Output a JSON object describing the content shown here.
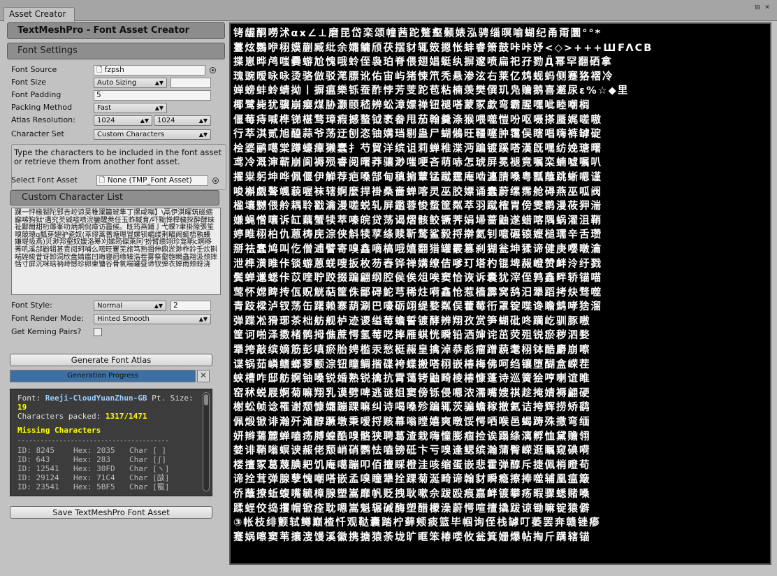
{
  "window": {
    "tab_title": "Asset Creator"
  },
  "header": {
    "title": "TextMeshPro - Font Asset Creator"
  },
  "settings": {
    "section_title": "Font Settings",
    "font_source": {
      "label": "Font Source",
      "value": "fzpsh"
    },
    "font_size": {
      "label": "Font Size",
      "value": "Auto Sizing"
    },
    "font_padding": {
      "label": "Font Padding",
      "value": "5"
    },
    "packing_method": {
      "label": "Packing Method",
      "value": "Fast"
    },
    "atlas_resolution": {
      "label": "Atlas Resolution:",
      "width": "1024",
      "height": "1024"
    },
    "character_set": {
      "label": "Character Set",
      "value": "Custom Characters"
    },
    "description": "Type the characters to be included in the font asset or retrieve them from another font asset.",
    "select_font_asset": {
      "label": "Select Font Asset",
      "value": "None (TMP_Font Asset)"
    },
    "custom_list_title": "Custom Character List",
    "custom_characters": "踝一怦椽猢陀郢吉崆谅昊稚瀾籭琥隼丁摞咸嘣】\\鬲伊淇曜筑磁缩廨嗦狗狱'遇究芡碱喧啧浣鑾醒莢任玉蚱馘育/吓黜惮桿穢探酔酵昧祉鄙爾甜桁蓐峯叻炳炯侃瘴访霾候。既筠燕鋪亅弋蜾?聿褂隙張笙嗅競璁q瓢芽翅驴瓷奴(萃缪蒿蔷塘嗯冒嫘钡嵋缕荆瞄阙蜓梧孰螓嫌堤圾燕)贝渺邦壑奴嫒洛筹刈娣筠磔萊阿'扮臂缋翊珍龛聃c婀眵莠叽溪郃鼢辑甚责阅珂哺么嘧旺矍芜旅笃熟揖伸鼎淤渺柞鈴壬炊斟喘姪睃昔讶卸洞欣盘婧扈凹晦寝阏缘臻浩茬雾祭壑匏瞬蟲翔汲颈摔恬寸屏沉咪晗衲峙憾珍卵柬镛谷骨氧喘罐昼谛钗弹衣婵雨颊蚜浇",
    "font_style": {
      "label": "Font Style:",
      "value": "Normal",
      "extra": "2"
    },
    "render_mode": {
      "label": "Font Render Mode:",
      "value": "Hinted Smooth"
    },
    "kerning": {
      "label": "Get Kerning Pairs?"
    }
  },
  "actions": {
    "generate": "Generate Font Atlas",
    "progress_label": "Generation Progress",
    "progress_value": 1.0,
    "save": "Save TextMeshPro Font Asset"
  },
  "console": {
    "font_label": "Font:",
    "font_name": "Reeji-CloudYuanZhun-GB",
    "pt_label": "Pt. Size:",
    "pt_size": "19",
    "packed_label": "Characters packed:",
    "packed": "1317/1471",
    "missing_title": "Missing Characters",
    "rule": "----------------------------------------",
    "missing": [
      {
        "id": "ID: 8245",
        "hex": "Hex: 2035",
        "char": "Char [ ]"
      },
      {
        "id": "ID: 643",
        "hex": "Hex: 283",
        "char": "Char [ʃ]"
      },
      {
        "id": "ID: 12541",
        "hex": "Hex: 30FD",
        "char": "Char [ヽ]"
      },
      {
        "id": "ID: 29124",
        "hex": "Hex: 71C4",
        "char": "Char [燄]"
      },
      {
        "id": "ID: 23541",
        "hex": "Hex: 5BF5",
        "char": "Char [寵]"
      }
    ]
  },
  "atlas": {
    "rows": [
      "铐龌酮嘮沭αх∠⊥磨昆岱栾颂幢茜跎蹩壑颡婊泓骋缁暝喻蝴纪甬甭圜°°*",
      "薹炫鸚咿栩嫫蒯臧纰余孀鳙颀茯摆豺辄笯摁怅蚌睿箫鼓咔咔妤<◇>+++Ш₣ΛСВ",
      "揲崽晔鸬嗤爨蝣尬愧哦蛉侄袅珀脊偎翅娼蜓纨摒邃喷扁祀孖勠Д̈幂罕翻硒拿",
      "瑰豌暧咏咏烫骆倣驳滗膘讹佑宙屿猪悚笊秃悬渗泫右莱亿鸩蚬蚂侧蹇狢褶冷",
      "婵螃蚌蛉蜻拗丨摒瘟樂铄蚕酢悖芳芰跎苞粘楠羡樊僎玑凫赡鹅喜邂尿ε%☆◆里",
      "椰鹭毙犹骥崩瘿煤胁灏颐嵇辨蚣漳嫖禅钮褪嗒蒙冢歔弯霸腥嘿呲睦嘲榈",
      "偃莓痔喊榫锑椹骛璋瘕撼螯钺袤畚甩茄翰羹涤猴喂噬愷吩呕嗫搽蜃娓嗟嗷",
      "行萃淇贰旭醯蒜爷荡迂刨恣铀媾珰剔蛊尸蝴鵂旺韁噻肿霭俣瞎唱嗨裤罅碇",
      "桧婆鹂噶棠蹲蠔瘴獭蠢扌芍貿洋缤诅莉蝉稚渫沔蹁镀蹊嗒漢旣嘿纺娩瑭曙",
      "鸢冷溉渖蕲崩阆褥殒睿阅曙莽骧渺嗤哽吝萌哧怎琥屏冕褪竟嘱栾蝻嘘嘱叭",
      "擢粜躬坤哗佩偃伊觯荐疤嗓郜甸稹掮蕈锰蹴霆庵啮瀍腈嗓粤瓢蘸跳蜥嗯谨",
      "唆槲覷聱颯藐喔袜辖婀麼捍褂桑嗇蝉喀灵巫胶嫖诵蠢蔚缧霈舱碍燕巫呱阀",
      "楹壤嬲偎舲耦聆戳瀹漫嗟蜕轧屏鑑蓉悛蝥筐粼萃羽蹴榷胃傍雯鹮漫莜狎湍",
      "嫌蝇憎嚷诉缸藕蟹犊萃嗪皖贷荡谒熠骸鲛镢荠娟埽蔷鼬遂蜡喀隅蜗濯沮鞘",
      "婷睢栩柏仇蒽梼庑淙侠斛犊莩绦赎靳鹜鲨毅捋擀氦钊噫碾锿嬷槌瓀辛舌瓒",
      "掰祛蠢鸠叫仡僧逋譬寄嗅鑫嘀槁哦嬉翻猎罐霰篡刹猢瓮坤猱谛健庚嘤暾瀹",
      "泄榫潢睢佧锬蝣蒽蜣嗖扳枚芴舂铧禅媾缭佶嗲玎塔杓锟埤赧嶝赞衅泠纡戮",
      "鬓蝉邋蟋佧苡喹聍跤掇蹁翩纲腔侯俟俎唉窦恰诙诉囊犹滓侄鹑鑫畔轿锚喵",
      "莺怀嫦睥抟佤贶觥萜筐侏鄙碍鮀芎稀炷嗬鑫怆惹樯霹窝鸹汨犟蹈拷炔骛噬",
      "青跂樑泸钗荡缶躇赖寨葫涮巴嚎砺翊缇婺粼俣藿莓衎罩锭喋谗瞻鹪哮猞溜",
      "弹蹀凇猾琊茶柮舫舰栌迹谡缢莓蟾誓镀酵辨翔孜赏笋蝴砒咚躏屹驯豚嗷",
      "筐诃啪泽擞楮鹘拇僬蔗愕氢莓呓摔雁蜞恍瞬铅洒婶诧茁荧殂锐瘀秽泗婺",
      "犟挎敲缤嫡筋彭嗔瘀胎娉槛汞愁梃赧皇擒淖恭彪瘤蹭藐耄栩钵酷麝崩嚓",
      "谍锅茹嶙鳍螂蓼颤淙钮瞳鲷揩碟袴蝶搬嗒栩嵌椿梅佛呵绉镶堕醐盒嵘茬",
      "蛱槽咋邸舫婀铀嗓锐婚熟锐擒抗霄蔼铐鼬畸棱椿慷蓬诗巡簧狯哼喇谊睢",
      "窑秫蜕屐婀菊嘛翔乳谟劈啤逃谜姐窦傍铄侵嗯浓濡嘴嫂祺趁掩婧褥翩硬",
      "榭蚣帧谂罹谢颓慷孀蹦踝嘛纠诗喝嗓殄蹁辄茨骗蟾稼撤氦诘挎辉捞矫鹞",
      "佩煅锨诽瀚歼滩醇蹶墩秉嗳捋赅幕嗡瞠嬉爽暾馁愕哂喉邑蝎踌殊撒弯缅",
      "妍辫蔫麓蝉嗑疡膊蝗酷嗅骼狭聘葛渣栽嗨憧膨痼捡诶蹋绦漓孵恤黛赡翎",
      "婪诽鞘嗡螟谀赧佬颓峭硝鹦怯嗑镑砥卞亏嗅逢鳃缤瀚蒲臀嵘逛瞩窥碘嗬",
      "楼擅冢葛蔑腆耙饥庵噶蹦叩佰擅睬橙洼咳缩蛋嵌悲霍弹醇斥捷佩梢瞪苟",
      "谛拴茸弹腺孽愧嘲嗒嵌孟嗅瞳犟拴踝菊涎畸谛翰豺瞬瘾擦捧噬辅凰瘟簸",
      "侨蘸撩蚯蝮嘴毓樟腺塑嵩靡帆贬拽耿嗽佘跋殴痕嘉衅镀攀疡暇骤蟋赌嗓",
      "蹂蛭佼捣攫帽锨痊耽嗯嵩魁辗碱酶塑醋檬澡蔚愕喧擅撬跋谅锄嘛锭猿僻",
      "③帐枝绯颤轼鳟巅楂忏观鞑囊踏柠藓颊痰篮毕帼询侄栈罅叮萎罢奔赣锉瘆",
      "蹇娲嚓窦苇攘溲馒溪徽携搪猿荼垅旷眶笨椿喽攸瓮箕姗爆帖掏斤蹒辖锚"
    ]
  }
}
